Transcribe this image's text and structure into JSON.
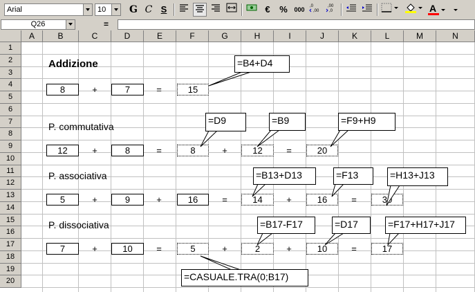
{
  "toolbar": {
    "font_name": "Arial",
    "font_size": "10",
    "bold": "G",
    "italic": "C",
    "underline": "S",
    "euro": "€",
    "percent": "%",
    "thousands": "000",
    "font_color_letter": "A"
  },
  "formula_bar": {
    "name_box": "Q26",
    "equals": "=",
    "content": ""
  },
  "columns": [
    "A",
    "B",
    "C",
    "D",
    "E",
    "F",
    "G",
    "H",
    "I",
    "J",
    "K",
    "L",
    "M",
    "N"
  ],
  "rows": [
    "1",
    "2",
    "3",
    "4",
    "5",
    "6",
    "7",
    "8",
    "9",
    "10",
    "11",
    "12",
    "13",
    "14",
    "15",
    "16",
    "17",
    "18",
    "19",
    "20"
  ],
  "sections": {
    "addizione": {
      "title": "Addizione",
      "b4": "8",
      "plus": "+",
      "d4": "7",
      "eq": "=",
      "f4": "15",
      "callout_f4": "=B4+D4"
    },
    "commutativa": {
      "title": "P. commutativa",
      "b9": "12",
      "plus1": "+",
      "d9": "8",
      "eq1": "=",
      "f9": "8",
      "plus2": "+",
      "h9": "12",
      "eq2": "=",
      "j9": "20",
      "callout_f9": "=D9",
      "callout_h9": "=B9",
      "callout_j9": "=F9+H9"
    },
    "associativa": {
      "title": "P. associativa",
      "b13": "5",
      "plus1": "+",
      "d13": "9",
      "plus2": "+",
      "f13": "16",
      "eq1": "=",
      "h13": "14",
      "plus3": "+",
      "j13": "16",
      "eq2": "=",
      "l13": "30",
      "callout_h13": "=B13+D13",
      "callout_j13": "=F13",
      "callout_l13": "=H13+J13"
    },
    "dissociativa": {
      "title": "P. dissociativa",
      "b17": "7",
      "plus1": "+",
      "d17": "10",
      "eq1": "=",
      "f17": "5",
      "plus2": "+",
      "h17": "2",
      "plus3": "+",
      "j17": "10",
      "eq2": "=",
      "l17": "17",
      "callout_h17": "=B17-F17",
      "callout_j17": "=D17",
      "callout_l17": "=F17+H17+J17",
      "callout_f17": "=CASUALE.TRA(0;B17)"
    }
  }
}
